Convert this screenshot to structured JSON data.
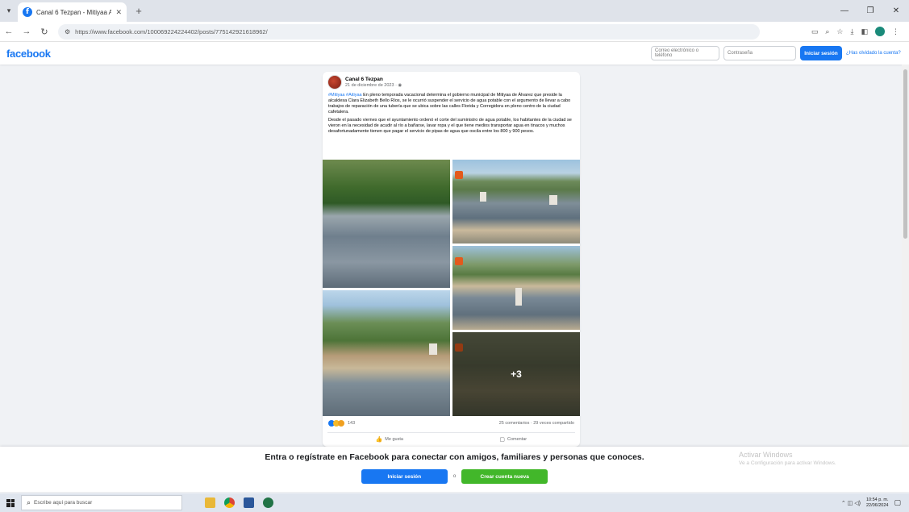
{
  "browser": {
    "tab_title": "Canal 6 Tezpan - Mitiyaa Aitiy...",
    "url": "https://www.facebook.com/100069224224402/posts/775142921618962/"
  },
  "facebook": {
    "logo": "facebook",
    "email_placeholder": "Correo electrónico o teléfono",
    "password_placeholder": "Contraseña",
    "login_button": "Iniciar sesión",
    "forgot_link": "¿Has olvidado la cuenta?"
  },
  "post": {
    "page_name": "Canal 6 Tezpan",
    "time": "21 de diciembre de 2023 · ",
    "hashtags": "#Mitiyaa #Aitiyaa",
    "paragraph1": " En pleno temporada vacacional determina el gobierno municipal de Mitiyaa de Álvarez que preside la alcaldesa Clara Elizabeth Bello Ríos, se le ocurrió suspender el servicio de agua potable con el argumento de llevar a cabo trabajos de reparación de una tubería que se ubica sobre las calles Florida y Corregidora en pleno centro de la ciudad cafetalera.",
    "paragraph2": "Desde el pasado viernes que el ayuntamiento ordenó el corte del suministro de agua potable, los habitantes de la ciudad se vieron en la necesidad de acudir al río a bañarse, lavar ropa y el que tiene medios transportar agua en tinacos y muchos desafortunadamente tienen que pagar el servicio de pipas de agua que oscila entre los 800 y 900 pesos.",
    "more_photos": "+3",
    "reaction_count": "143",
    "counts": "25 comentarios · 29 veces compartido",
    "like_label": "Me gusta",
    "comment_label": "Comentar"
  },
  "banner": {
    "text": "Entra o regístrate en Facebook para conectar con amigos, familiares y personas que conoces.",
    "login_button": "Iniciar sesión",
    "or": "o",
    "signup_button": "Crear cuenta nueva"
  },
  "watermark": {
    "title": "Activar Windows",
    "subtitle": "Ve a Configuración para activar Windows."
  },
  "taskbar": {
    "search_placeholder": "Escribe aquí para buscar",
    "time": "10:54 p. m.",
    "date": "22/06/2024"
  },
  "colors": {
    "facebook_blue": "#1877f2",
    "signup_green": "#42b72a",
    "page_background": "#f0f2f5"
  }
}
